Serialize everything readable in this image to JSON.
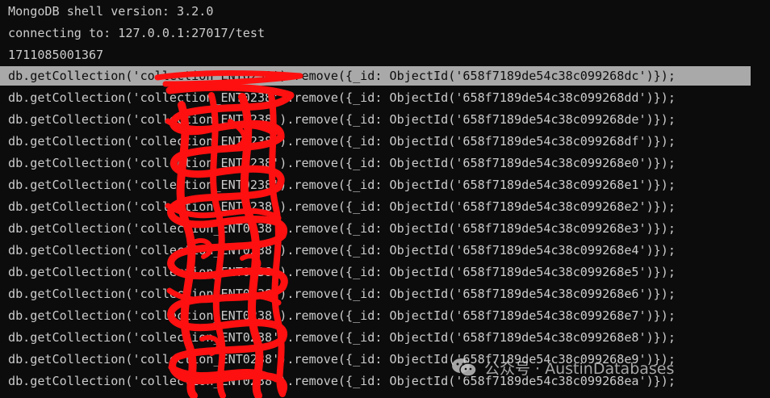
{
  "terminal": {
    "header": [
      "MongoDB shell version: 3.2.0",
      "connecting to: 127.0.0.1:27017/test",
      "1711085001367"
    ],
    "commands": [
      "db.getCollection('collection_ENT0238').remove({_id: ObjectId('658f7189de54c38c099268dc')});",
      "db.getCollection('collection_ENT0238').remove({_id: ObjectId('658f7189de54c38c099268dd')});",
      "db.getCollection('collection_ENT0238').remove({_id: ObjectId('658f7189de54c38c099268de')});",
      "db.getCollection('collection_ENT0238').remove({_id: ObjectId('658f7189de54c38c099268df')});",
      "db.getCollection('collection_ENT0238').remove({_id: ObjectId('658f7189de54c38c099268e0')});",
      "db.getCollection('collection_ENT0238').remove({_id: ObjectId('658f7189de54c38c099268e1')});",
      "db.getCollection('collection_ENT0238').remove({_id: ObjectId('658f7189de54c38c099268e2')});",
      "db.getCollection('collection_ENT0238').remove({_id: ObjectId('658f7189de54c38c099268e3')});",
      "db.getCollection('collection_ENT0238').remove({_id: ObjectId('658f7189de54c38c099268e4')});",
      "db.getCollection('collection_ENT0238').remove({_id: ObjectId('658f7189de54c38c099268e5')});",
      "db.getCollection('collection_ENT0238').remove({_id: ObjectId('658f7189de54c38c099268e6')});",
      "db.getCollection('collection_ENT0238').remove({_id: ObjectId('658f7189de54c38c099268e7')});",
      "db.getCollection('collection_ENT0238').remove({_id: ObjectId('658f7189de54c38c099268e8')});",
      "db.getCollection('collection_ENT0238').remove({_id: ObjectId('658f7189de54c38c099268e9')});",
      "db.getCollection('collection_ENT0238').remove({_id: ObjectId('658f7189de54c38c099268ea')});"
    ]
  },
  "watermark": {
    "text": "公众号 · AustinDatabases",
    "icon": "wechat-icon"
  },
  "colors": {
    "background": "#0c0c0c",
    "text": "#cccccc",
    "selection": "#a9a9a9",
    "redaction": "#ff0000"
  }
}
